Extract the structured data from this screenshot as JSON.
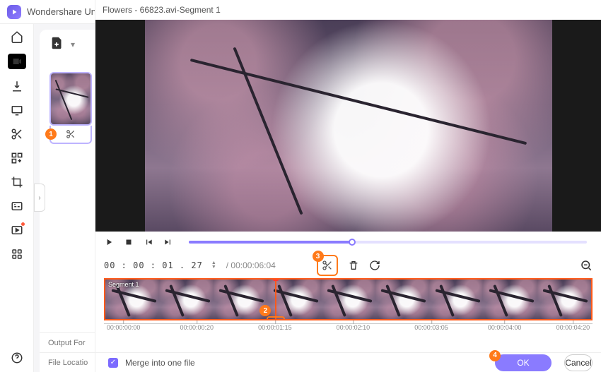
{
  "app_title": "Wondershare UniC",
  "editor": {
    "title": "Flowers - 66823.avi-Segment 1",
    "timecode": "00 : 00 : 01 . 27",
    "duration": "/ 00:00:06:04",
    "segment_label": "Segment 1",
    "merge_label": "Merge into one file",
    "ok_label": "OK",
    "cancel_label": "Cancel",
    "output_label": "Output For",
    "location_label": "File Locatio"
  },
  "ruler_ticks": [
    "00:00:00:00",
    "00:00:00:20",
    "00:00:01:15",
    "00:00:02:10",
    "00:00:03:05",
    "00:00:04:00",
    "00:00:04:20"
  ],
  "badges": {
    "b1": "1",
    "b2": "2",
    "b3": "3",
    "b4": "4"
  },
  "colors": {
    "accent": "#8a7bff",
    "callout": "#ff7a1a"
  }
}
